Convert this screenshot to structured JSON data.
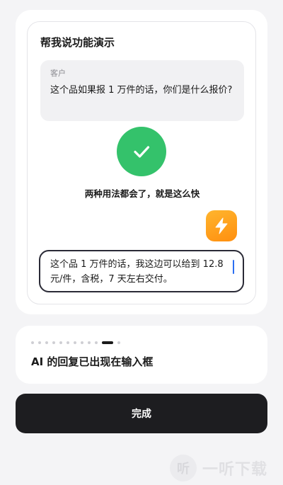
{
  "demo": {
    "title": "帮我说功能演示",
    "customer_label": "客户",
    "customer_message": "这个品如果报 1 万件的话，你们是什么报价?",
    "success_text": "两种用法都会了，就是这么快",
    "reply_text": "这个品 1 万件的话，我这边可以给到 12.8 元/件，含税，7 天左右交付。",
    "check_icon": "check-icon",
    "lightning_icon": "lightning-icon"
  },
  "onboarding": {
    "step_caption": "AI 的回复已出现在输入框",
    "total_steps": 12,
    "current_step": 11
  },
  "done_button_label": "完成",
  "watermark": {
    "logo_glyph": "听",
    "text": "一听下载"
  },
  "colors": {
    "success_green": "#34c26b",
    "lightning_orange": "#ff9f1a",
    "primary_dark": "#1d1d20",
    "cursor_blue": "#2b6ff2"
  }
}
